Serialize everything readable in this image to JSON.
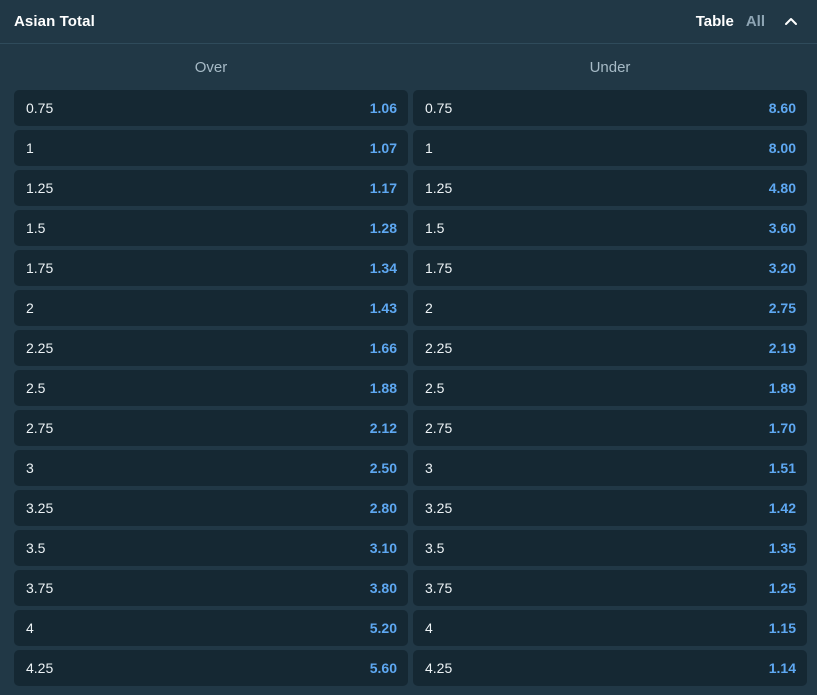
{
  "header": {
    "title": "Asian Total",
    "views": {
      "table": "Table",
      "all": "All"
    },
    "collapse_icon": "chevron-up-icon"
  },
  "columns": {
    "over": "Over",
    "under": "Under"
  },
  "over_rows": [
    {
      "line": "0.75",
      "odd": "1.06"
    },
    {
      "line": "1",
      "odd": "1.07"
    },
    {
      "line": "1.25",
      "odd": "1.17"
    },
    {
      "line": "1.5",
      "odd": "1.28"
    },
    {
      "line": "1.75",
      "odd": "1.34"
    },
    {
      "line": "2",
      "odd": "1.43"
    },
    {
      "line": "2.25",
      "odd": "1.66"
    },
    {
      "line": "2.5",
      "odd": "1.88"
    },
    {
      "line": "2.75",
      "odd": "2.12"
    },
    {
      "line": "3",
      "odd": "2.50"
    },
    {
      "line": "3.25",
      "odd": "2.80"
    },
    {
      "line": "3.5",
      "odd": "3.10"
    },
    {
      "line": "3.75",
      "odd": "3.80"
    },
    {
      "line": "4",
      "odd": "5.20"
    },
    {
      "line": "4.25",
      "odd": "5.60"
    }
  ],
  "under_rows": [
    {
      "line": "0.75",
      "odd": "8.60"
    },
    {
      "line": "1",
      "odd": "8.00"
    },
    {
      "line": "1.25",
      "odd": "4.80"
    },
    {
      "line": "1.5",
      "odd": "3.60"
    },
    {
      "line": "1.75",
      "odd": "3.20"
    },
    {
      "line": "2",
      "odd": "2.75"
    },
    {
      "line": "2.25",
      "odd": "2.19"
    },
    {
      "line": "2.5",
      "odd": "1.89"
    },
    {
      "line": "2.75",
      "odd": "1.70"
    },
    {
      "line": "3",
      "odd": "1.51"
    },
    {
      "line": "3.25",
      "odd": "1.42"
    },
    {
      "line": "3.5",
      "odd": "1.35"
    },
    {
      "line": "3.75",
      "odd": "1.25"
    },
    {
      "line": "4",
      "odd": "1.15"
    },
    {
      "line": "4.25",
      "odd": "1.14"
    }
  ],
  "colors": {
    "panel_bg": "#213846",
    "row_bg": "#152833",
    "odd_text": "#5ea8f2",
    "header_text": "#ffffff",
    "inactive_text": "#8ea5b4"
  }
}
